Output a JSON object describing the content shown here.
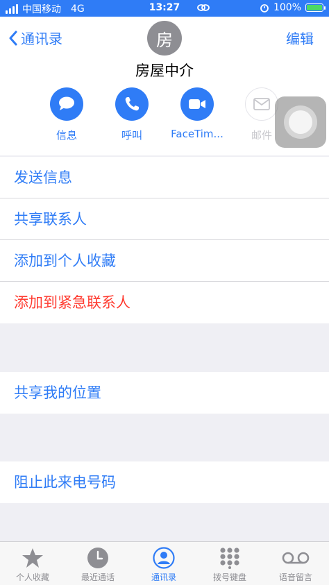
{
  "status_bar": {
    "carrier": "中国移动",
    "network": "4G",
    "time": "13:27",
    "battery": "100%"
  },
  "nav": {
    "back_label": "通讯录",
    "edit_label": "编辑"
  },
  "contact": {
    "avatar_initial": "房",
    "name": "房屋中介"
  },
  "actions": [
    {
      "label": "信息",
      "icon": "message-icon",
      "enabled": true
    },
    {
      "label": "呼叫",
      "icon": "phone-icon",
      "enabled": true
    },
    {
      "label": "FaceTim...",
      "icon": "video-icon",
      "enabled": true
    },
    {
      "label": "邮件",
      "icon": "mail-icon",
      "enabled": false
    }
  ],
  "options": {
    "send_message": "发送信息",
    "share_contact": "共享联系人",
    "add_favorite": "添加到个人收藏",
    "add_emergency": "添加到紧急联系人",
    "share_location": "共享我的位置",
    "block_caller": "阻止此来电号码"
  },
  "tabs": [
    {
      "label": "个人收藏",
      "icon": "star-icon"
    },
    {
      "label": "最近通话",
      "icon": "clock-icon"
    },
    {
      "label": "通讯录",
      "icon": "contacts-icon",
      "active": true
    },
    {
      "label": "拨号键盘",
      "icon": "keypad-icon"
    },
    {
      "label": "语音留言",
      "icon": "voicemail-icon"
    }
  ],
  "colors": {
    "accent": "#2f7cf6",
    "danger": "#ff3b30",
    "background": "#efeff4"
  }
}
